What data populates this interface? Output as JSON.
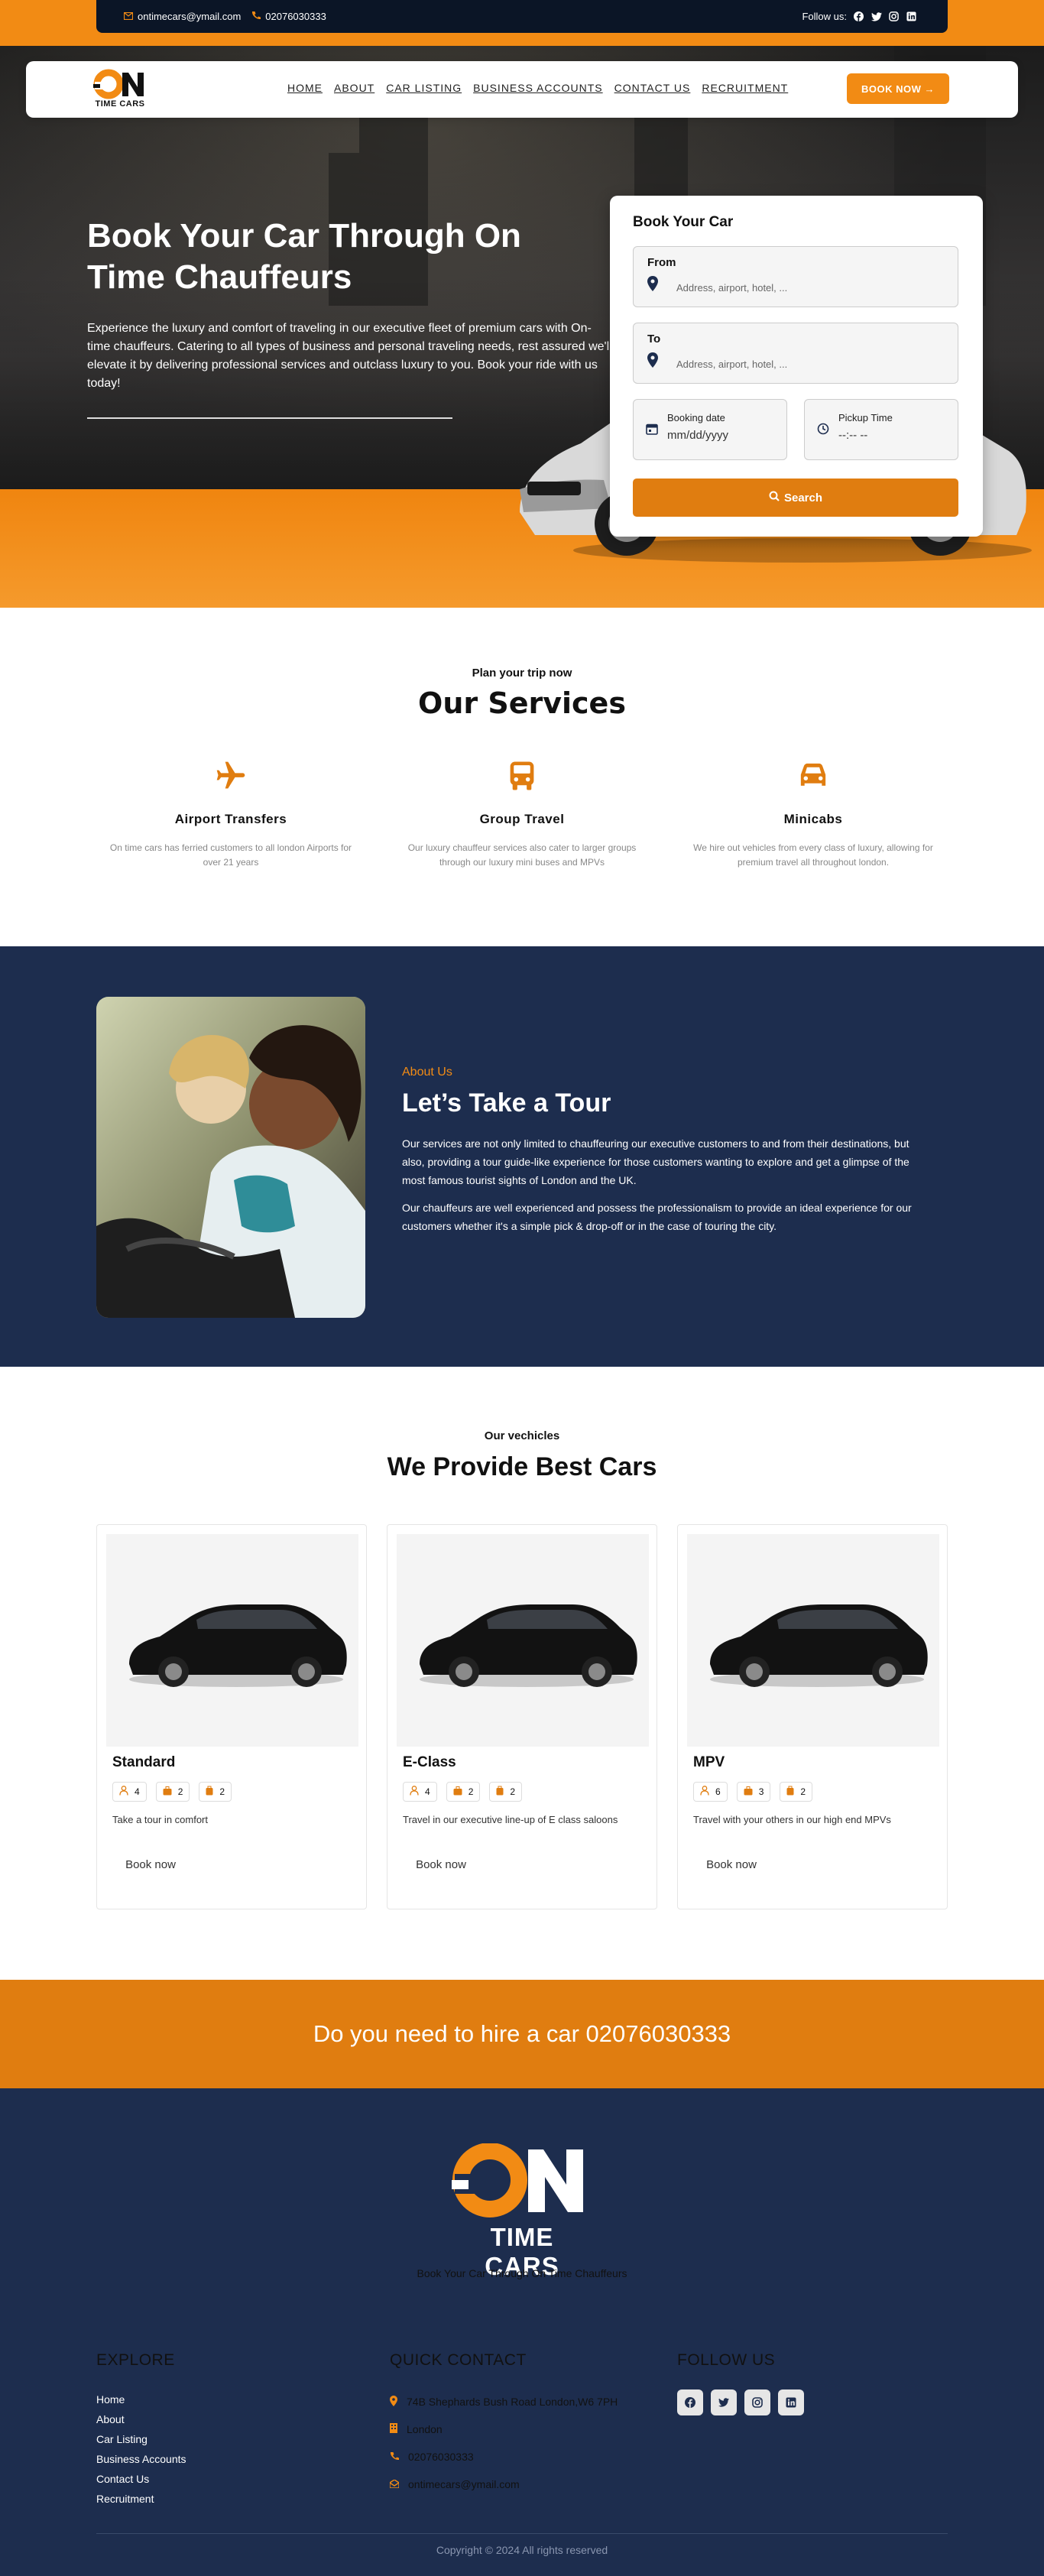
{
  "topbar": {
    "email": "ontimecars@ymail.com",
    "phone": "02076030333",
    "follow_label": "Follow us:",
    "social_icons": [
      "facebook-icon",
      "twitter-icon",
      "instagram-icon",
      "linkedin-icon"
    ]
  },
  "nav": {
    "logo_text": "TIME CARS",
    "links": [
      "HOME",
      "ABOUT",
      "CAR LISTING",
      "BUSINESS ACCOUNTS",
      "CONTACT US",
      "RECRUITMENT"
    ],
    "book_now": "BOOK NOW →"
  },
  "hero": {
    "title": "Book Your Car Through On Time Chauffeurs",
    "description": "Experience the luxury and comfort of traveling in our executive fleet of premium cars with On-time chauffeurs. Catering to all types of business and personal traveling needs, rest assured we'll elevate it by delivering professional services and outclass luxury to you. Book your ride with us today!"
  },
  "booking": {
    "title": "Book Your Car",
    "from_label": "From",
    "from_placeholder": "Address, airport, hotel, ...",
    "to_label": "To",
    "to_placeholder": "Address, airport, hotel, ...",
    "date_label": "Booking date",
    "date_value": "mm/dd/yyyy",
    "time_label": "Pickup Time",
    "time_value": "--:-- --",
    "search_label": "Search"
  },
  "services": {
    "subtitle": "Plan your trip now",
    "title": "Our Services",
    "items": [
      {
        "title": "Airport Transfers",
        "text": "On time cars has ferried customers to all london Airports for over 21 years"
      },
      {
        "title": "Group Travel",
        "text": "Our luxury chauffeur services also cater to larger groups through our luxury mini buses and MPVs"
      },
      {
        "title": "Minicabs",
        "text": "We hire out vehicles from every class of luxury, allowing for premium travel all throughout london."
      }
    ]
  },
  "about": {
    "kicker": "About Us",
    "title": "Let’s Take a Tour",
    "p1": "Our services are not only limited to chauffeuring our executive customers to and from their destinations, but also, providing a tour guide-like experience for those customers wanting to explore and get a glimpse of the most famous tourist sights of London and the UK.",
    "p2": "Our chauffeurs are well experienced and possess the professionalism to provide an ideal experience for our customers whether it's a simple pick & drop-off or in the case of touring the city."
  },
  "vehicles": {
    "subtitle": "Our vechicles",
    "title": "We Provide Best Cars",
    "cards": [
      {
        "name": "Standard",
        "passengers": "4",
        "luggage": "2",
        "bags": "2",
        "desc": "Take a tour in comfort",
        "book": "Book now"
      },
      {
        "name": "E-Class",
        "passengers": "4",
        "luggage": "2",
        "bags": "2",
        "desc": "Travel in our executive line-up of E class saloons",
        "book": "Book now"
      },
      {
        "name": "MPV",
        "passengers": "6",
        "luggage": "3",
        "bags": "2",
        "desc": "Travel with your others in our high end MPVs",
        "book": "Book now"
      }
    ]
  },
  "cta": {
    "text": "Do you need to hire a car 02076030333"
  },
  "footer": {
    "tagline": "Book Your Car Through On Time Chauffeurs",
    "explore_title": "EXPLORE",
    "explore_links": [
      "Home",
      "About",
      "Car Listing",
      "Business Accounts",
      "Contact Us",
      "Recruitment"
    ],
    "contact_title": "QUICK CONTACT",
    "address": "74B Shephards Bush Road London,W6 7PH",
    "city": "London",
    "phone": "02076030333",
    "email": "ontimecars@ymail.com",
    "follow_title": "FOLLOW US",
    "copyright": "Copyright © 2024 All rights reserved"
  },
  "colors": {
    "accent": "#f28b14",
    "navy": "#1d2d4e",
    "topbar": "#0b1526"
  }
}
